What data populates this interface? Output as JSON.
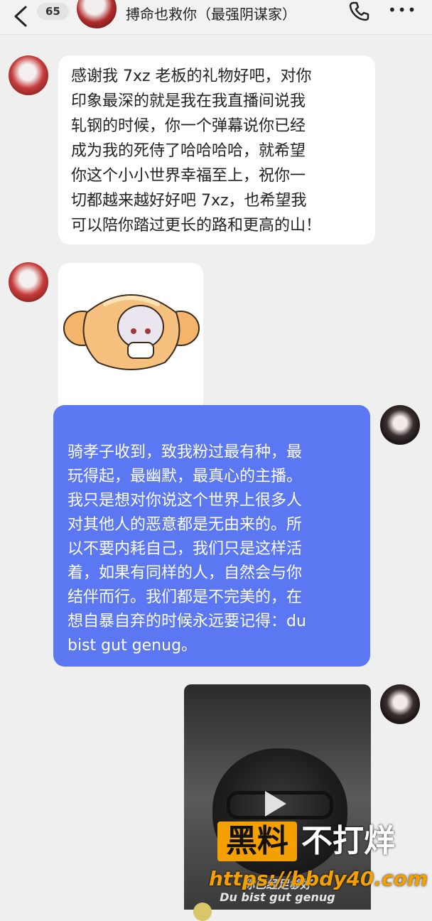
{
  "header": {
    "unread_count": "65",
    "title": "搏命也救你（最强阴谋家）",
    "back_icon": "chevron-left-icon",
    "phone_icon": "phone-icon",
    "more_icon": "more-horizontal-icon",
    "more_label": "•••"
  },
  "messages": [
    {
      "side": "left",
      "lines": [
        "感谢我 7xz 老板的礼物好吧，对你",
        "印象最深的就是我在我直播间说我",
        "轧钢的时候，你一个弹幕说你已经",
        "成为我的死侍了哈哈哈哈，就希望",
        "你这个小小世界幸福至上，祝你一",
        "切都越来越好好吧 7xz，也希望我",
        "可以陪你踏过更长的路和更高的山！"
      ]
    },
    {
      "side": "left",
      "sticker": "croissant-character-sticker"
    },
    {
      "side": "right",
      "bubble_color": "#5b78f2",
      "lines": [
        "骑孝子收到，致我粉过最有种，最",
        "玩得起，最幽默，最真心的主播。",
        "我只是想对你说这个世界上很多人",
        "对其他人的恶意都是无由来的。所",
        "以不要内耗自己，我们只是这样活",
        "着，如果有同样的人，自然会与你",
        "结伴而行。我们都是不完美的，在",
        "想自暴自弃的时候永远要记得：du",
        "bist gut genug。"
      ]
    },
    {
      "side": "right",
      "video": {
        "subtitle_cn": "你已经足够好",
        "subtitle_de": "Du bist gut genug",
        "play_icon": "play-icon"
      }
    }
  ],
  "watermark": {
    "box_text": "黑料",
    "text": "不打烊",
    "url": "https://bbdy40.com",
    "accent": "#f3a000"
  }
}
